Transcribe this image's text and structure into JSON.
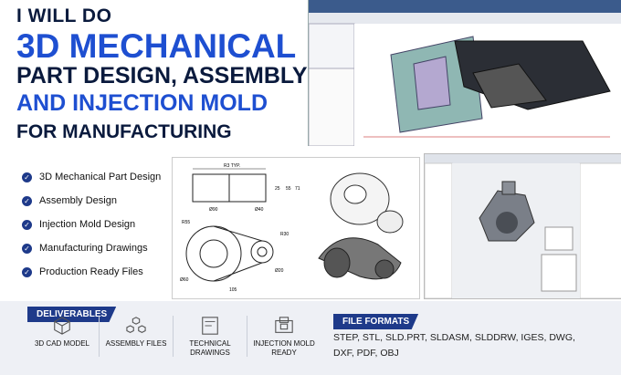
{
  "headline": {
    "line1": "I WILL DO",
    "line2": "3D MECHANICAL",
    "line3": "PART DESIGN, ASSEMBLY",
    "line4": "AND INJECTION MOLD",
    "line5": "FOR MANUFACTURING"
  },
  "features": [
    {
      "label": "3D Mechanical Part Design"
    },
    {
      "label": "Assembly Design"
    },
    {
      "label": "Injection Mold Design"
    },
    {
      "label": "Manufacturing Drawings"
    },
    {
      "label": "Production Ready Files"
    }
  ],
  "drawing_labels": {
    "r3typ": "R3 TYP.",
    "d90": "Ø90",
    "d40": "Ø40",
    "l25": "25",
    "l55": "55",
    "l71": "71",
    "r55": "R55",
    "r30": "R30",
    "d60": "Ø60",
    "d20": "Ø20",
    "l105": "105"
  },
  "deliverables": {
    "title": "DELIVERABLES",
    "items": [
      {
        "label": "3D CAD MODEL",
        "icon": "cube-icon"
      },
      {
        "label": "ASSEMBLY FILES",
        "icon": "assembly-icon"
      },
      {
        "label": "TECHNICAL DRAWINGS",
        "icon": "drawing-icon"
      },
      {
        "label": "INJECTION MOLD READY",
        "icon": "mold-icon"
      }
    ]
  },
  "formats": {
    "title": "FILE FORMATS",
    "line1": "STEP, STL, SLD.PRT, SLDASM, SLDDRW, IGES, DWG,",
    "line2": "DXF, PDF, OBJ"
  }
}
